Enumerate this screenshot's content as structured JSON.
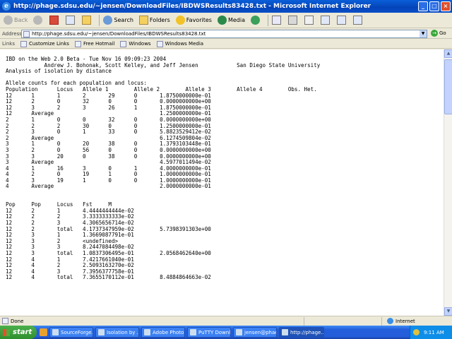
{
  "window": {
    "title": "http://phage.sdsu.edu/~jensen/DownloadFiles/IBDWSResults83428.txt - Microsoft Internet Explorer"
  },
  "toolbar": {
    "back": "Back",
    "search": "Search",
    "favorites": "Favorites",
    "folders": "Folders",
    "media": "Media"
  },
  "address": {
    "label": "Address",
    "url": "http://phage.sdsu.edu/~jensen/DownloadFiles/IBDWSResults83428.txt",
    "go": "Go"
  },
  "links": {
    "label": "Links",
    "items": [
      "Customize Links",
      "Free Hotmail",
      "Windows",
      "Windows Media"
    ]
  },
  "document": {
    "lines": [
      "IBD on the Web 2.0 Beta - Tue Nov 16 09:09:23 2004",
      "            Andrew J. Bohonak, Scott Kelley, and Jeff Jensen            San Diego State University",
      "Analysis of isolation by distance",
      "",
      "Allele counts for each population and locus:",
      "Population      Locus   Allele 1        Allele 2        Allele 3        Allele 4        Obs. Het.",
      "12      1       1       2       29      0       1.8750000000e-01",
      "12      2       0       32      0       0       0.0000000000e+00",
      "12      3       2       3       26      1       1.8750000000e-01",
      "12      Average                                 1.2500000000e-01",
      "2       1       0       0       32      0       0.0000000000e+00",
      "2       2       2       30      0       0       1.2500000000e-01",
      "2       3       0       1       33      0       5.8823529412e-02",
      "2       Average                                 6.1274509804e-02",
      "3       1       0       20      38      0       1.3793103448e-01",
      "3       2       0       56      0       0       0.0000000000e+00",
      "3       3       20      0       38      0       0.0000000000e+00",
      "3       Average                                 4.5977011494e-02",
      "4       1       16      3       0       1       4.0000000000e-01",
      "4       2       0       19      1       0       1.0000000000e-01",
      "4       3       19      1       0       0       1.0000000000e-01",
      "4       Average                                 2.0000000000e-01",
      "",
      "",
      "Pop     Pop     Locus   Fst     M",
      "12      2       1       4.4444444444e-02",
      "12      2       2       3.3333333333e-02",
      "12      2       3       4.3065656714e-02",
      "12      2       total   4.1737347959e-02        5.7398391303e+00",
      "12      3       1       1.3669087791e-01",
      "12      3       2       <undefined>",
      "12      3       3       8.2447084498e-02",
      "12      3       total   1.0837306495e-01        2.0568462640e+00",
      "12      4       1       7.4217661040e-01",
      "12      4       2       2.5093163270e-02",
      "12      4       3       7.3956377758e-01",
      "12      4       total   7.3655170112e-01        8.4884864663e-02"
    ]
  },
  "status": {
    "text": "Done",
    "zone": "Internet"
  },
  "taskbar": {
    "start": "start",
    "tasks": [
      "SourceForge...",
      "Isolation by ...",
      "Adobe Photo...",
      "PuTTY Downl...",
      "jensen@phae...",
      "http://phage...."
    ],
    "clock": "9:11 AM"
  }
}
